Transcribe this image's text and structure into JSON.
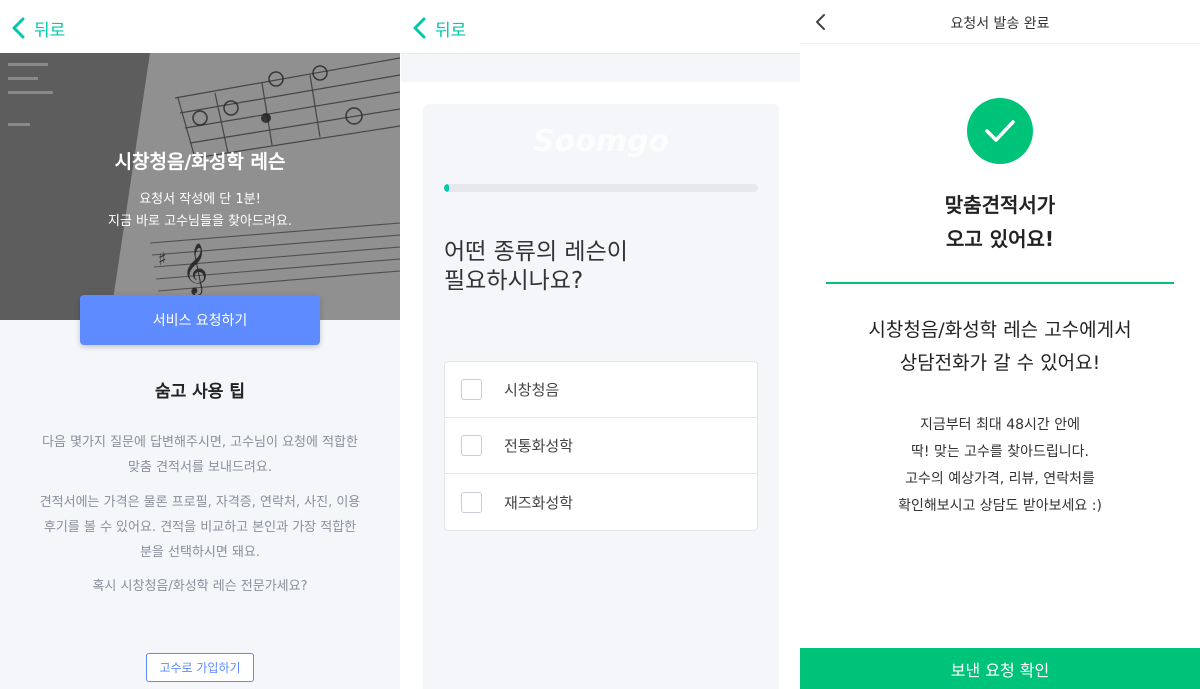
{
  "screen1": {
    "back_label": "뒤로",
    "hero_title": "시창청음/화성학 레슨",
    "hero_sub_line1": "요청서 작성에 단 1분!",
    "hero_sub_line2": "지금 바로 고수님들을 찾아드려요.",
    "request_button": "서비스 요청하기",
    "tips_title": "숨고 사용 팁",
    "tip1_line1": "다음 몇가지 질문에 답변해주시면, 고수님이 요청에 적합한",
    "tip1_line2": "맞춤 견적서를 보내드려요.",
    "tip2_line1": "견적서에는 가격은 물론 프로필, 자격증, 연락처, 사진, 이용",
    "tip2_line2": "후기를 볼 수 있어요. 견적을 비교하고 본인과 가장 적합한",
    "tip2_line3": "분을 선택하시면 돼요.",
    "tip3": "혹시 시창청음/화성학 레슨 전문가세요?",
    "join_button": "고수로 가입하기"
  },
  "screen2": {
    "back_label": "뒤로",
    "progress": 0.01,
    "question_line1": "어떤 종류의 레슨이",
    "question_line2": "필요하시나요?",
    "options": [
      {
        "label": "시창청음"
      },
      {
        "label": "전통화성학"
      },
      {
        "label": "재즈화성학"
      }
    ]
  },
  "screen3": {
    "title": "요청서 발송 완료",
    "headline_line1": "맞춤견적서가",
    "headline_line2": "오고 있어요!",
    "message_line1": "시창청음/화성학 레슨 고수에게서",
    "message_line2": "상담전화가 갈 수 있어요!",
    "desc_line1": "지금부터 최대 48시간 안에",
    "desc_line2": "딱! 맞는 고수를 찾아드립니다.",
    "desc_line3": "고수의 예상가격, 리뷰, 연락처를",
    "desc_line4": "확인해보시고 상담도 받아보세요 :)",
    "confirm_button": "보낸 요청 확인"
  },
  "colors": {
    "accent_teal": "#00c7ae",
    "accent_green": "#00c37a",
    "primary_blue": "#5e8bff"
  }
}
